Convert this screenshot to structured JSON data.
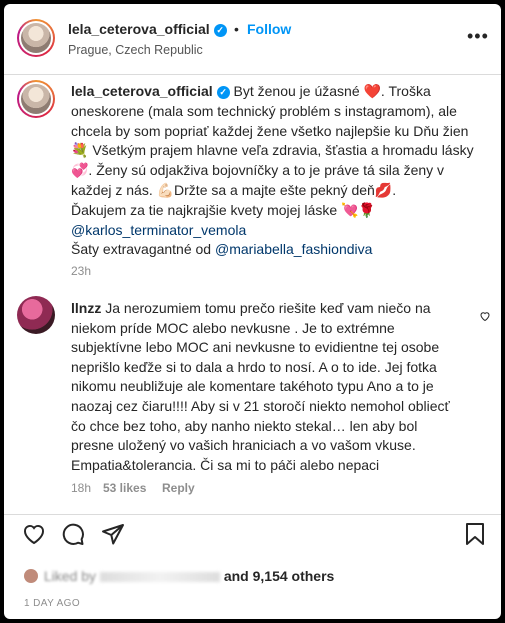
{
  "header": {
    "username": "lela_ceterova_official",
    "location": "Prague, Czech Republic",
    "follow_label": "Follow",
    "separator": "•",
    "more_label": "•••"
  },
  "caption": {
    "username": "lela_ceterova_official",
    "text_1": " Byt ženou je úžasné ❤️. Troška oneskorene (mala som technický problém s instagramom), ale chcela by som popriať každej žene všetko najlepšie ku Dňu žien 💐 Všetkým prajem hlavne veľa zdravia, šťastia a hromadu lásky 💞. Ženy sú odjakživa bojovníčky a to je práve tá sila ženy v každej z nás. 💪🏻Držte sa a majte ešte pekný deň💋.",
    "text_2": "Ďakujem za tie najkrajšie kvety mojej láske 💘🌹",
    "mention_1": "@karlos_terminator_vemola",
    "text_3": "Šaty extravagantné od ",
    "mention_2": "@mariabella_fashiondiva",
    "time": "23h"
  },
  "comment": {
    "username": "llnzz",
    "text": " Ja nerozumiem tomu prečo riešite keď vam niečo na niekom príde MOC alebo nevkusne . Je to extrémne subjektívne lebo MOC ani nevkusne to evidientne tej osobe neprišlo keďže si to dala a hrdo to nosí. A o to ide. Jej fotka nikomu neubližuje ale komentare takéhoto typu Ano a to je naozaj cez čiaru!!!! Aby si v 21 storočí niekto nemohol obliecť čo chce bez toho, aby nanho niekto stekal… len aby bol presne uložený vo vašich hraniciach a vo vašom vkuse. Empatia&tolerancia. Či sa mi to páči alebo nepaci",
    "time": "18h",
    "likes": "53 likes",
    "reply_label": "Reply"
  },
  "footer": {
    "likes_prefix": "Liked by",
    "likes_suffix": "and 9,154 others",
    "date": "1 DAY AGO"
  },
  "icons": {
    "verified": "verified-badge",
    "like": "heart-icon",
    "comment": "comment-icon",
    "share": "paper-plane-icon",
    "save": "bookmark-icon"
  },
  "colors": {
    "link": "#00376b",
    "follow": "#0095f6",
    "muted": "#8e8e8e"
  }
}
